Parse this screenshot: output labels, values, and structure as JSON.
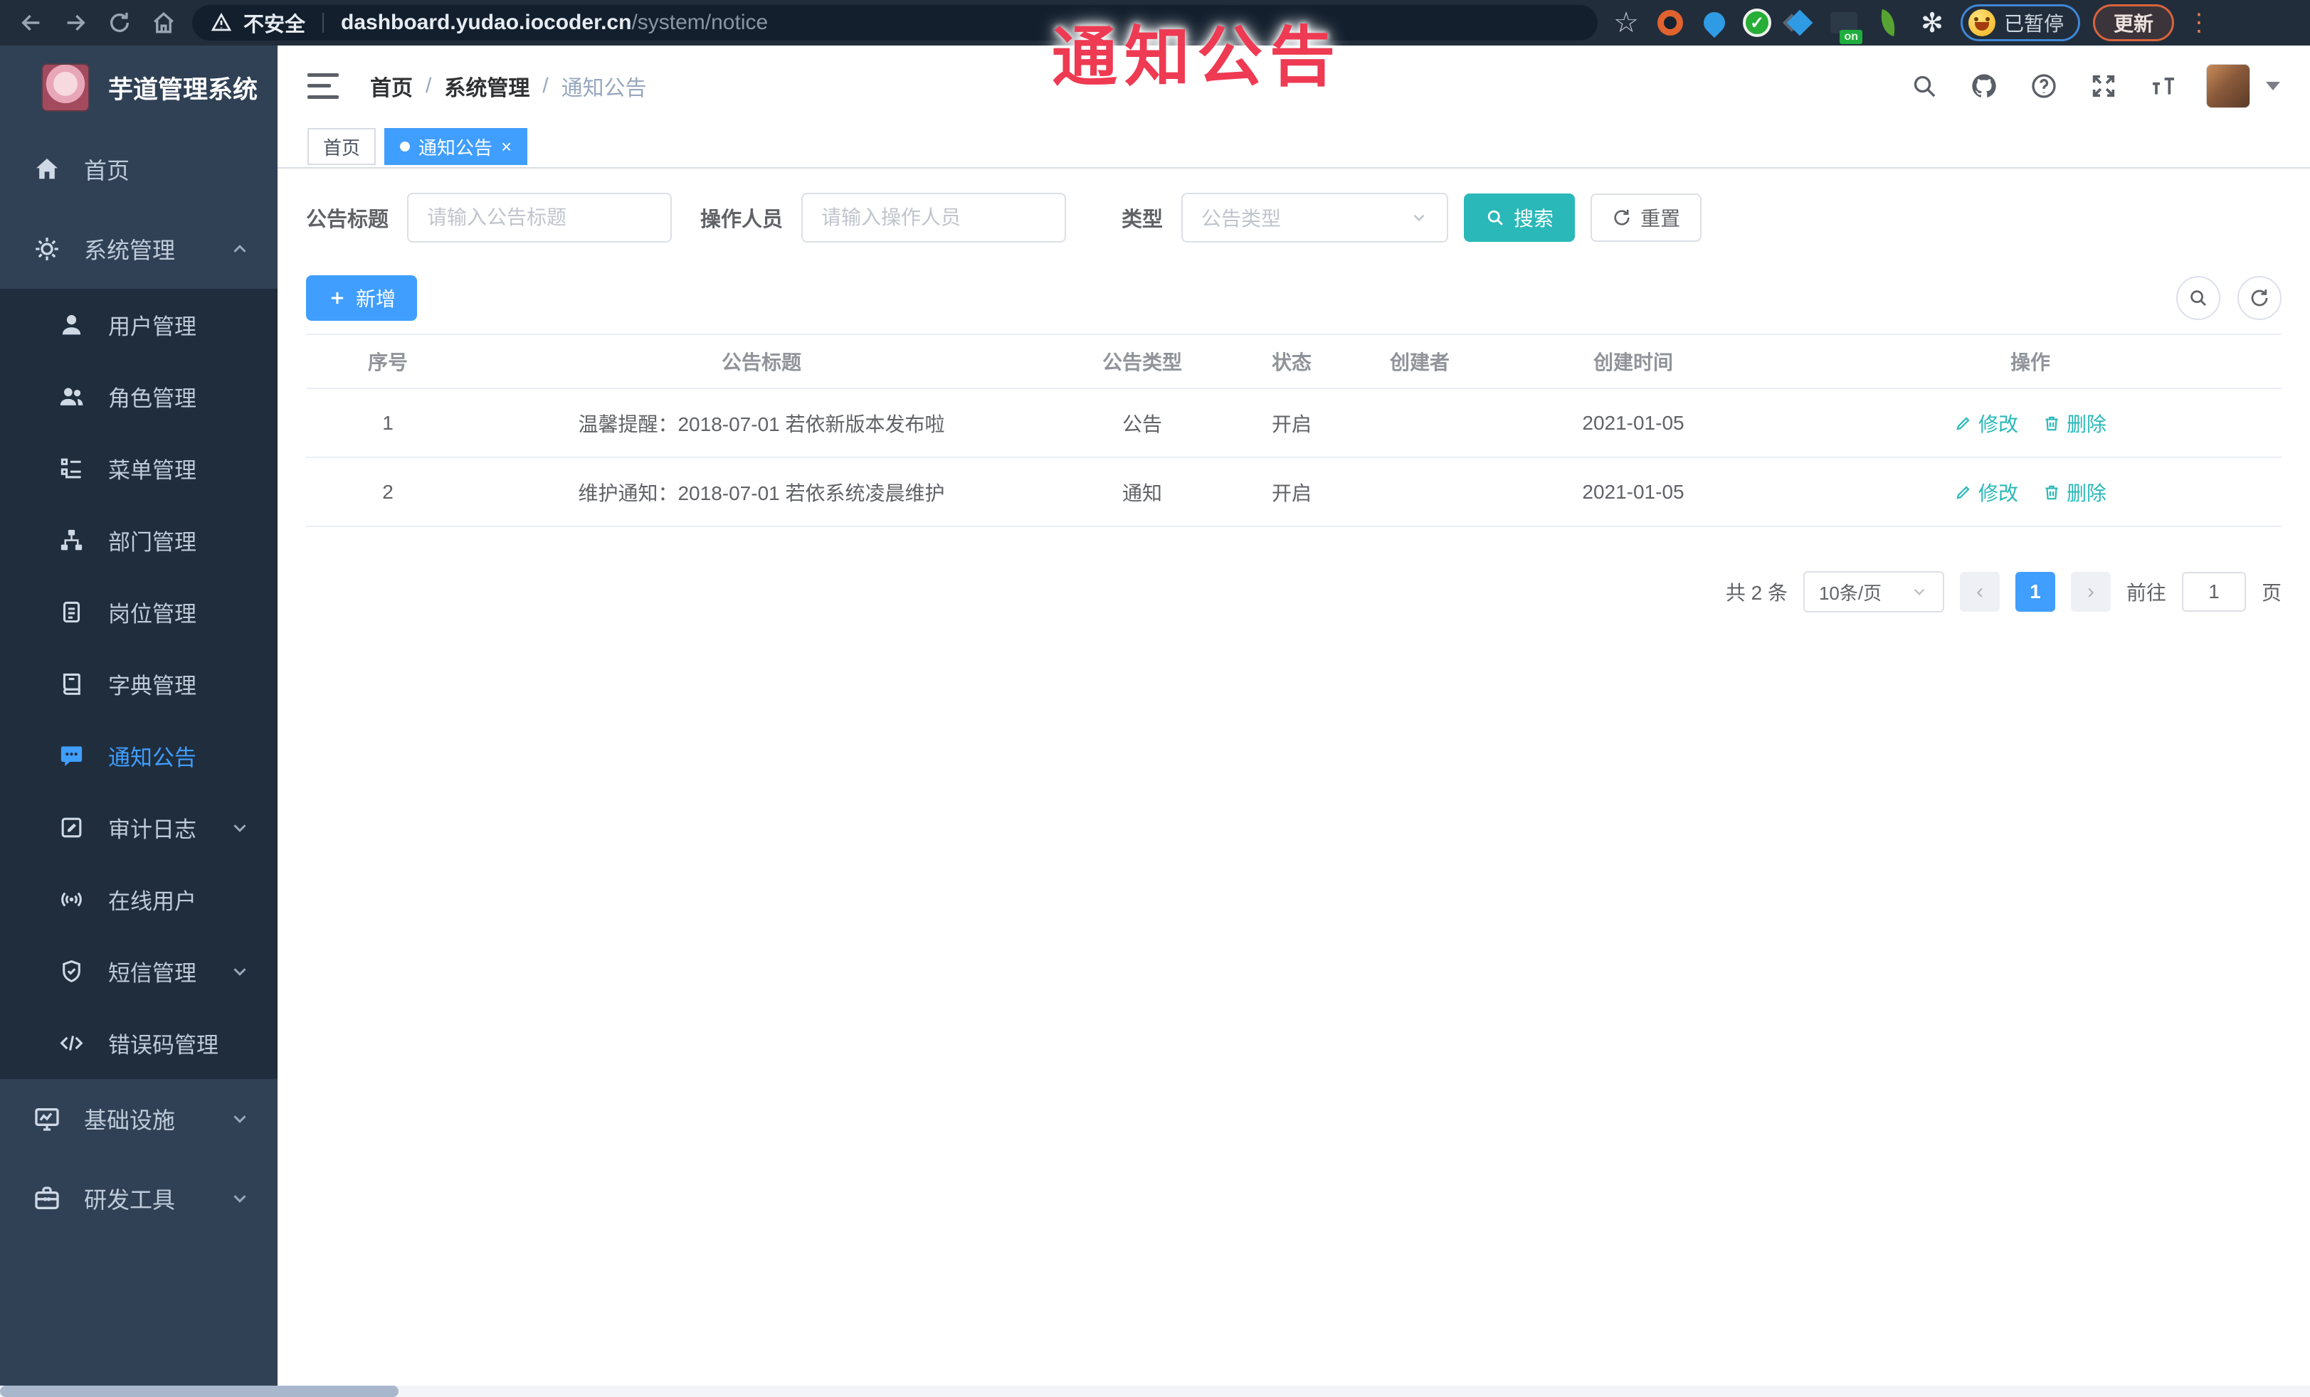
{
  "browser": {
    "security_label": "不安全",
    "url_host": "dashboard.yudao.iocoder.cn",
    "url_path": "/system/notice",
    "extension_on_badge": "on",
    "paused_label": "已暂停",
    "update_label": "更新"
  },
  "overlay": {
    "text": "通知公告"
  },
  "sidebar": {
    "title": "芋道管理系统",
    "items": [
      {
        "label": "首页"
      },
      {
        "label": "系统管理"
      },
      {
        "label": "用户管理"
      },
      {
        "label": "角色管理"
      },
      {
        "label": "菜单管理"
      },
      {
        "label": "部门管理"
      },
      {
        "label": "岗位管理"
      },
      {
        "label": "字典管理"
      },
      {
        "label": "通知公告"
      },
      {
        "label": "审计日志"
      },
      {
        "label": "在线用户"
      },
      {
        "label": "短信管理"
      },
      {
        "label": "错误码管理"
      },
      {
        "label": "基础设施"
      },
      {
        "label": "研发工具"
      }
    ]
  },
  "header": {
    "breadcrumb": {
      "home": "首页",
      "section": "系统管理",
      "current": "通知公告"
    }
  },
  "tabs": {
    "home": "首页",
    "current": "通知公告"
  },
  "filters": {
    "title_label": "公告标题",
    "title_placeholder": "请输入公告标题",
    "operator_label": "操作人员",
    "operator_placeholder": "请输入操作人员",
    "type_label": "类型",
    "type_placeholder": "公告类型",
    "search_label": "搜索",
    "reset_label": "重置"
  },
  "toolbar": {
    "add_label": "新增"
  },
  "table": {
    "columns": {
      "index": "序号",
      "title": "公告标题",
      "type": "公告类型",
      "status": "状态",
      "creator": "创建者",
      "created": "创建时间",
      "actions": "操作"
    },
    "edit_label": "修改",
    "delete_label": "删除",
    "rows": [
      {
        "index": "1",
        "title": "温馨提醒：2018-07-01 若依新版本发布啦",
        "type": "公告",
        "status": "开启",
        "creator": "",
        "created": "2021-01-05"
      },
      {
        "index": "2",
        "title": "维护通知：2018-07-01 若依系统凌晨维护",
        "type": "通知",
        "status": "开启",
        "creator": "",
        "created": "2021-01-05"
      }
    ]
  },
  "pagination": {
    "total_label": "共 2 条",
    "page_size_label": "10条/页",
    "prev_label": "‹",
    "current_page": "1",
    "next_label": "›",
    "goto_label": "前往",
    "goto_value": "1",
    "page_unit_label": "页"
  },
  "colors": {
    "accent_blue": "#409eff",
    "accent_teal": "#2ab8b8",
    "sidebar_bg": "#304156",
    "submenu_bg": "#1f2d3d",
    "chrome_bg": "#212d3b",
    "overlay_red": "#ee3a52"
  }
}
